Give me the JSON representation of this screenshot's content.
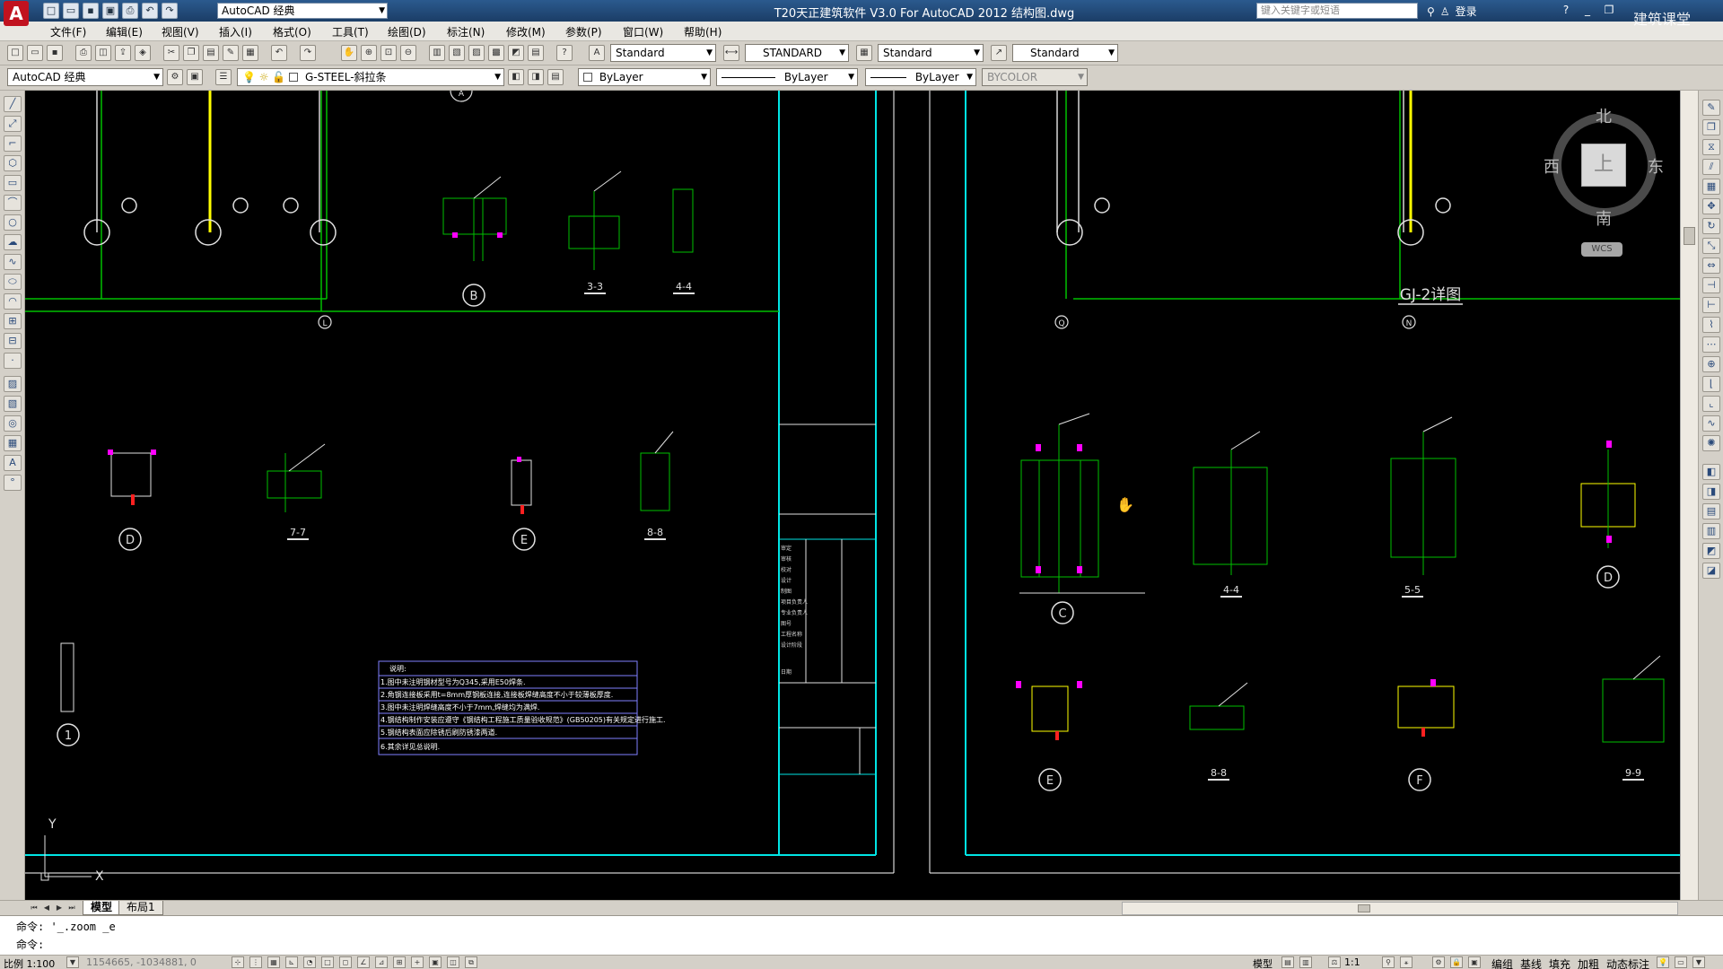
{
  "title_bar": {
    "logo": "A",
    "workspace": "AutoCAD 经典",
    "window_title": "T20天正建筑软件 V3.0 For AutoCAD 2012     结构图.dwg",
    "search_placeholder": "键入关键字或短语",
    "login": "登录",
    "watermark": "建筑课堂"
  },
  "menu": [
    "文件(F)",
    "编辑(E)",
    "视图(V)",
    "插入(I)",
    "格式(O)",
    "工具(T)",
    "绘图(D)",
    "标注(N)",
    "修改(M)",
    "参数(P)",
    "窗口(W)",
    "帮助(H)"
  ],
  "styles_toolbar": {
    "text_style": "Standard",
    "dim_style": "STANDARD",
    "table_style": "Standard",
    "multileader_style": "Standard"
  },
  "layers_toolbar": {
    "workspace": "AutoCAD 经典",
    "layer": "G-STEEL-斜拉条",
    "color": "ByLayer",
    "linetype": "ByLayer",
    "lineweight": "ByLayer",
    "plotstyle": "BYCOLOR"
  },
  "drawing": {
    "detail_title": "GJ-2详图",
    "labels": {
      "b": "B",
      "d1": "D",
      "e1": "E",
      "one": "1",
      "c": "C",
      "d2": "D",
      "e2": "E",
      "f": "F",
      "sec33": "3-3",
      "sec44a": "4-4",
      "sec77": "7-7",
      "sec88a": "8-8",
      "sec44b": "4-4",
      "sec55": "5-5",
      "sec88b": "8-8",
      "sec99": "9-9",
      "axis_l": "L",
      "axis_q": "Q",
      "axis_n": "N",
      "axis_a": "A"
    },
    "notes_title": "说明:",
    "notes": [
      "1.图中未注明钢材型号为Q345,采用E50焊条.",
      "2.角钢连接板采用t=8mm厚钢板连接,连接板焊缝高度不小于较薄板厚度.",
      "3.图中未注明焊缝高度不小于7mm,焊缝均为满焊.",
      "4.钢结构制作安装应遵守《钢结构工程施工质量验收规范》(GB50205)有关规定进行施工.",
      "5.钢结构表面应除锈后刷防锈漆两道.",
      "6.其余详见总说明."
    ],
    "title_block_rows": [
      "审定",
      "审核",
      "校对",
      "设计",
      "制图",
      "项目负责人",
      "专业负责人",
      "图号",
      "工程名称",
      "设计阶段",
      "日期"
    ],
    "ucs_x": "X",
    "ucs_y": "Y"
  },
  "viewcube": {
    "north": "北",
    "south": "南",
    "east": "东",
    "west": "西",
    "face": "上",
    "wcs": "WCS"
  },
  "tabs": [
    "模型",
    "布局1"
  ],
  "command": {
    "line1": "命令: '_.zoom _e",
    "line2": "命令:"
  },
  "status": {
    "scale": "比例 1:100",
    "coords": "1154665, -1034881, 0",
    "model": "模型",
    "annotation_scale": "1:1",
    "right_buttons": [
      "编组",
      "基线",
      "填充",
      "加粗",
      "动态标注"
    ]
  },
  "colors": {
    "canvas": "#000000",
    "frame": "#00e5e5",
    "green_lines": "#00c000",
    "yellow": "#ffff00",
    "magenta": "#ff00ff"
  }
}
